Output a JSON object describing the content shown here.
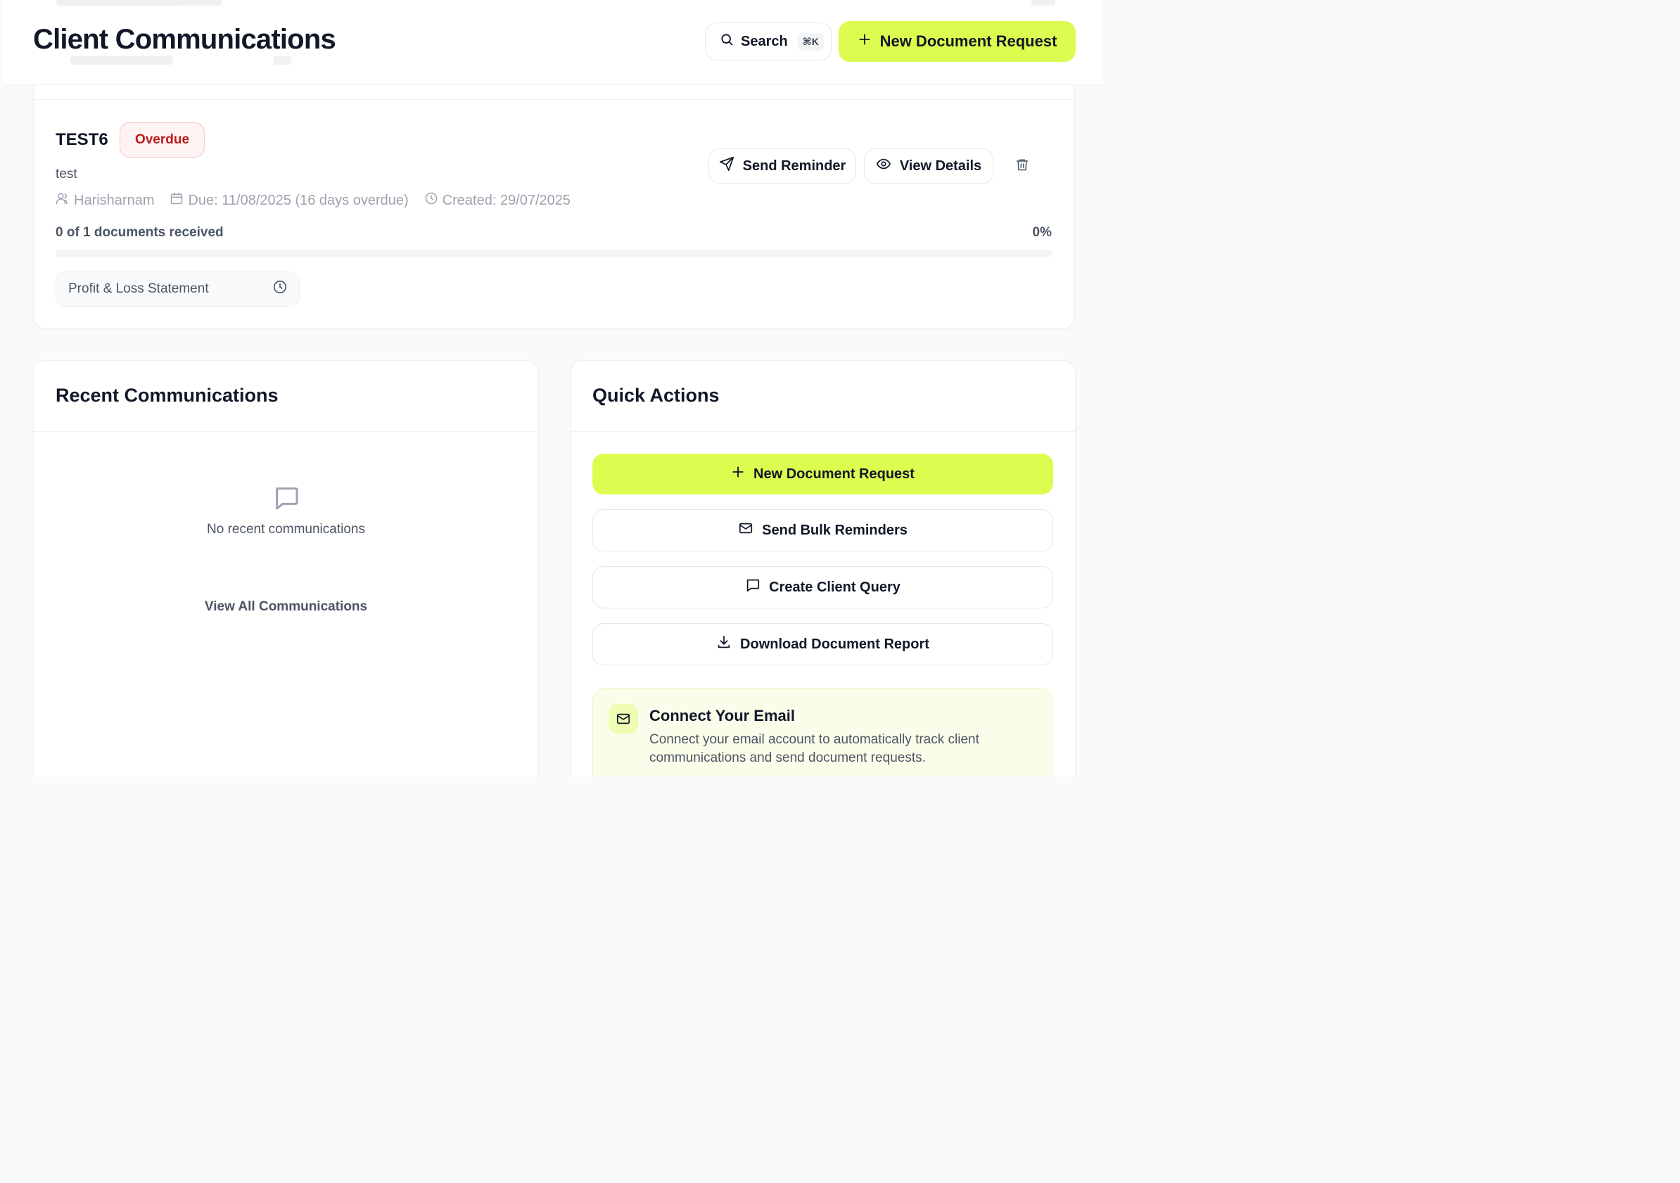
{
  "header": {
    "title": "Client Communications",
    "search_label": "Search",
    "search_shortcut": "⌘K",
    "new_request_label": "New Document Request"
  },
  "request": {
    "name": "TEST6",
    "status": "Overdue",
    "description": "test",
    "client": "Harisharnam",
    "due": "Due: 11/08/2025 (16 days overdue)",
    "created": "Created: 29/07/2025",
    "send_reminder_label": "Send Reminder",
    "view_details_label": "View Details",
    "docs_received": "0 of 1 documents received",
    "progress_pct": "0%",
    "progress_value": 0,
    "documents": [
      {
        "name": "Profit & Loss Statement",
        "icon": "clock-icon"
      }
    ]
  },
  "recent": {
    "title": "Recent Communications",
    "empty_text": "No recent communications",
    "view_all_label": "View All Communications"
  },
  "quick_actions": {
    "title": "Quick Actions",
    "new_request_label": "New Document Request",
    "bulk_reminders_label": "Send Bulk Reminders",
    "client_query_label": "Create Client Query",
    "download_report_label": "Download Document Report",
    "email_card": {
      "title": "Connect Your Email",
      "description": "Connect your email account to automatically track client communications and send document requests."
    }
  },
  "colors": {
    "accent": "#dcfc50",
    "overdue_text": "#b91c1c",
    "overdue_bg": "#fef2f2"
  }
}
